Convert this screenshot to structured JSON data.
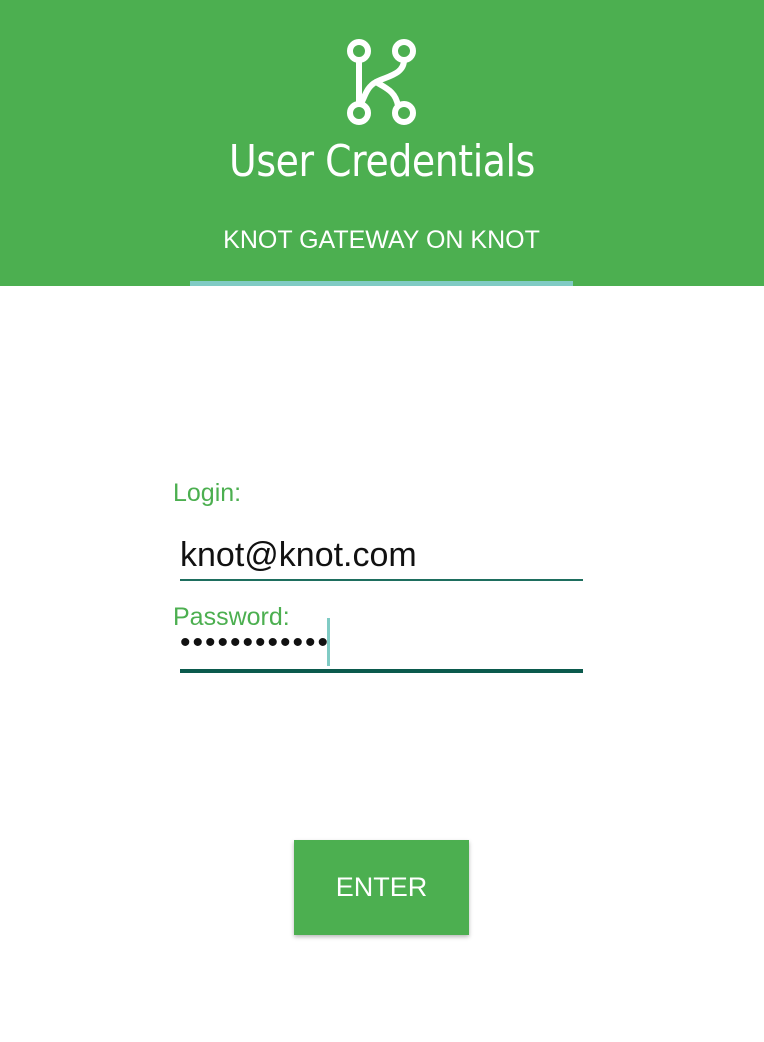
{
  "header": {
    "logo_icon": "knot-logo-icon",
    "title": "User Credentials",
    "tab_label": "KNOT GATEWAY ON KNOT",
    "background_color": "#4caf50",
    "tab_indicator_color": "#80cbc4"
  },
  "form": {
    "login_label": "Login:",
    "login_value": "knot@knot.com",
    "password_label": "Password:",
    "password_value": "••••••••••••"
  },
  "actions": {
    "enter_label": "ENTER"
  }
}
